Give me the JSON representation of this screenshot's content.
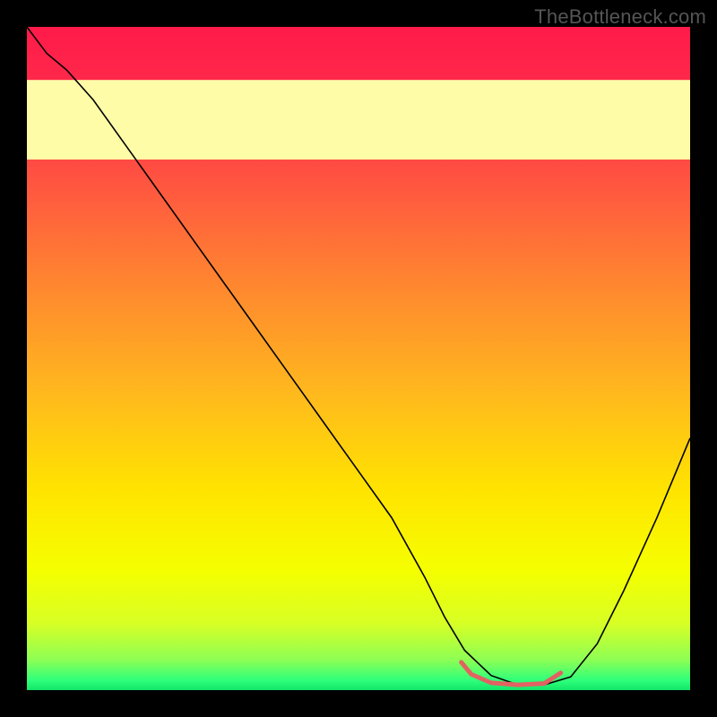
{
  "watermark": "TheBottleneck.com",
  "chart_data": {
    "type": "line",
    "title": "",
    "xlabel": "",
    "ylabel": "",
    "xlim": [
      0,
      100
    ],
    "ylim": [
      0,
      100
    ],
    "grid": false,
    "legend": false,
    "gradient": {
      "stops": [
        {
          "offset": 0.0,
          "color": "#ff1a4a"
        },
        {
          "offset": 0.12,
          "color": "#ff2f4a"
        },
        {
          "offset": 0.25,
          "color": "#ff5a3f"
        },
        {
          "offset": 0.4,
          "color": "#ff8a2e"
        },
        {
          "offset": 0.55,
          "color": "#ffb81e"
        },
        {
          "offset": 0.7,
          "color": "#ffe400"
        },
        {
          "offset": 0.82,
          "color": "#f5ff00"
        },
        {
          "offset": 0.9,
          "color": "#d7ff25"
        },
        {
          "offset": 0.955,
          "color": "#8cff55"
        },
        {
          "offset": 0.985,
          "color": "#2fff7a"
        },
        {
          "offset": 1.0,
          "color": "#12e56a"
        }
      ]
    },
    "yellow_band": {
      "from": 80,
      "to": 92,
      "color": "#fffca8"
    },
    "series": [
      {
        "name": "bottleneck-curve",
        "color": "#000000",
        "width": 1.6,
        "x": [
          0,
          3,
          6,
          10,
          15,
          20,
          25,
          30,
          35,
          40,
          45,
          50,
          55,
          60,
          63,
          66,
          70,
          74,
          78,
          82,
          86,
          90,
          95,
          100
        ],
        "y": [
          100,
          96,
          93.5,
          89,
          82,
          75,
          68,
          61,
          54,
          47,
          40,
          33,
          26,
          17,
          11,
          6,
          2.2,
          0.8,
          0.8,
          2.0,
          7,
          15,
          26,
          38
        ]
      },
      {
        "name": "optimal-segment",
        "color": "#e26262",
        "width": 5,
        "cap": "round",
        "x": [
          65.5,
          67,
          70,
          74,
          78,
          80.5
        ],
        "y": [
          4.2,
          2.4,
          1.1,
          0.8,
          1.0,
          2.6
        ]
      }
    ]
  }
}
